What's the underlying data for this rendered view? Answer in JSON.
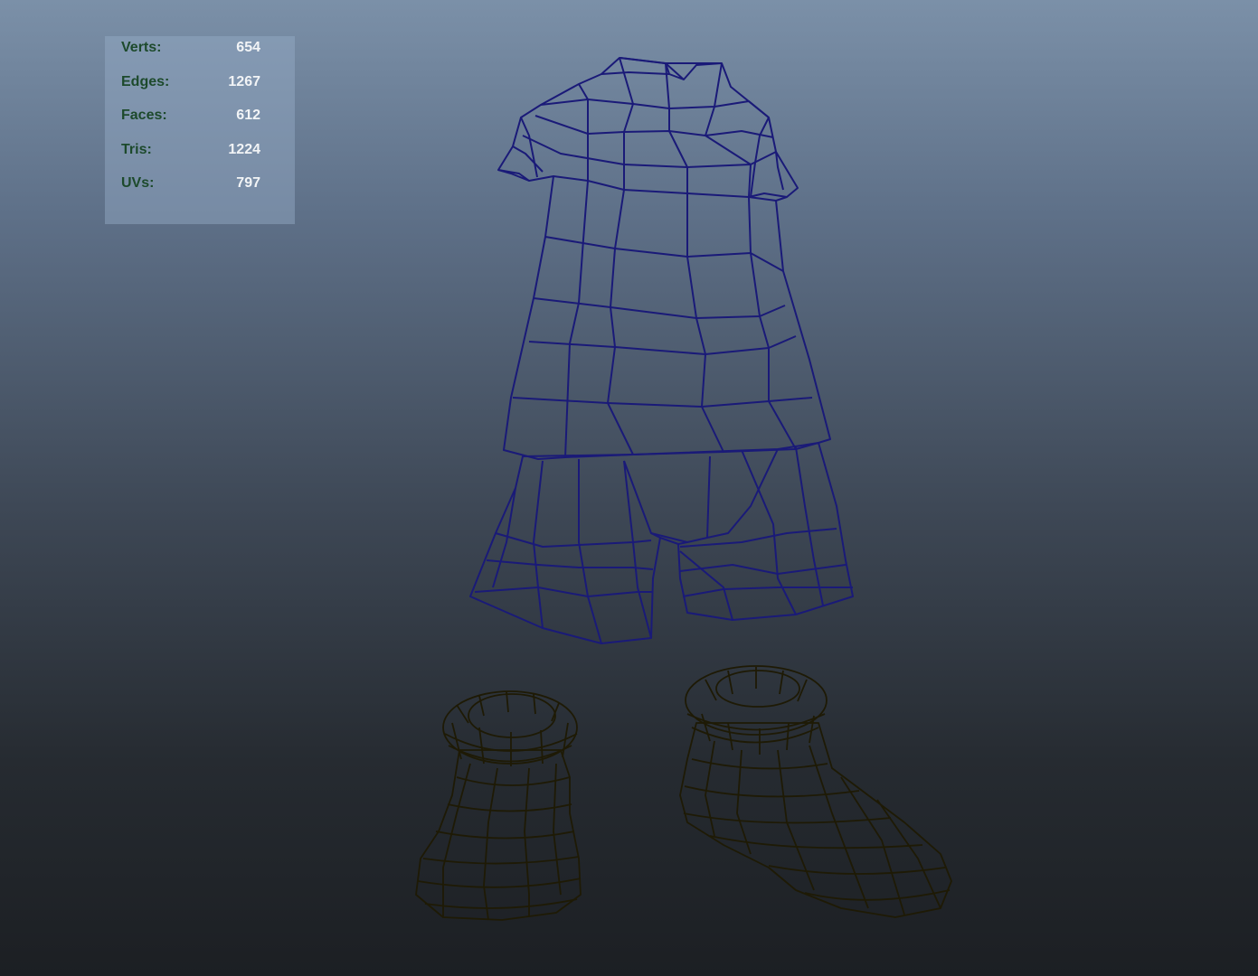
{
  "heads_up_display": {
    "poly_count": [
      {
        "label": "Verts:",
        "value": "654"
      },
      {
        "label": "Edges:",
        "value": "1267"
      },
      {
        "label": "Faces:",
        "value": "612"
      },
      {
        "label": "Tris:",
        "value": "1224"
      },
      {
        "label": "UVs:",
        "value": "797"
      }
    ]
  },
  "scene": {
    "objects": [
      "shirt-mesh",
      "shorts-mesh",
      "left-boot-mesh",
      "right-boot-mesh"
    ],
    "colors": {
      "background_top": "#7b90a8",
      "background_bottom": "#1c1f23",
      "wireframe_cloth": "#1a1a78",
      "cloth_shading": "#c8c9cc",
      "boot_shading": "#f5a800",
      "wireframe_boot": "#1e1a05",
      "hud_label": "#1d4a2c",
      "hud_value": "#f2f4f6"
    }
  }
}
